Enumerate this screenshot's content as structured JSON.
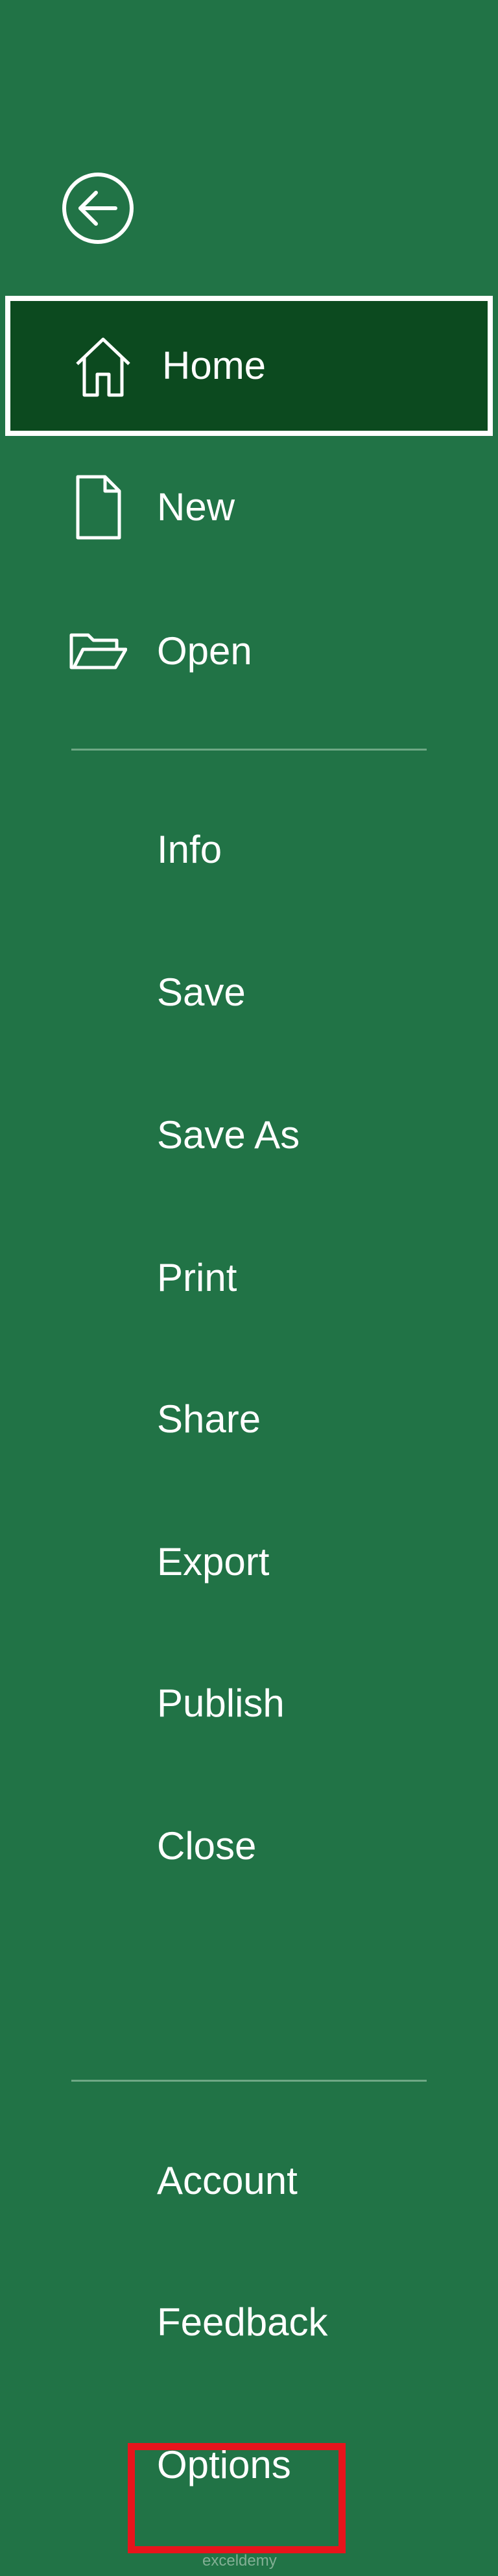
{
  "menu": {
    "primary": [
      {
        "label": "Home",
        "icon": "home-icon"
      },
      {
        "label": "New",
        "icon": "new-document-icon"
      },
      {
        "label": "Open",
        "icon": "open-folder-icon"
      }
    ],
    "secondary": [
      {
        "label": "Info"
      },
      {
        "label": "Save"
      },
      {
        "label": "Save As"
      },
      {
        "label": "Print"
      },
      {
        "label": "Share"
      },
      {
        "label": "Export"
      },
      {
        "label": "Publish"
      },
      {
        "label": "Close"
      }
    ],
    "footer": [
      {
        "label": "Account"
      },
      {
        "label": "Feedback"
      },
      {
        "label": "Options"
      }
    ],
    "selected": "Home",
    "highlighted": "Options"
  },
  "watermark": "exceldemy",
  "colors": {
    "background": "#217346",
    "selected_background": "#0c4a1f",
    "highlight": "#e8141c",
    "text": "#ffffff"
  }
}
